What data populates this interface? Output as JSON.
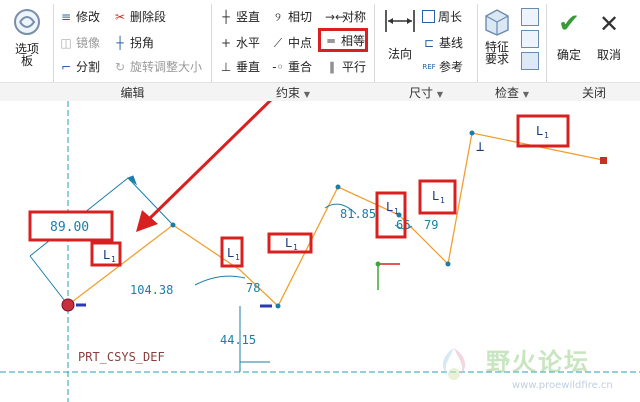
{
  "ribbon": {
    "selection": {
      "label": "选项\n板"
    },
    "edit": {
      "title": "编辑",
      "items": [
        "修改",
        "删除段",
        "镜像",
        "拐角",
        "分割",
        "旋转调整大小"
      ]
    },
    "constraints": {
      "title": "约束",
      "items": [
        "竖直",
        "相切",
        "对称",
        "水平",
        "中点",
        "相等",
        "垂直",
        "重合",
        "平行"
      ]
    },
    "dimension": {
      "title": "尺寸",
      "normal": "法向",
      "items": [
        "周长",
        "基线",
        "参考"
      ]
    },
    "inspect": {
      "title": "检查",
      "feature": "特征\n要求"
    },
    "close": {
      "title": "关闭",
      "ok": "确定",
      "cancel": "取消"
    }
  },
  "sketch": {
    "dims": {
      "angle": "89.00",
      "length": "104.38",
      "angle2": "78",
      "height": "44.15",
      "angle3": "81.85",
      "angle4": "66",
      "angle5": "79"
    },
    "csys_label": "PRT_CSYS_DEF",
    "equal_symbol": "L",
    "equal_subscript": "1"
  },
  "watermark": {
    "brand": "野火论坛",
    "url": "www.proewildfire.cn"
  },
  "colors": {
    "sketch_line": "#f0a030",
    "dimension": "#1a7fa8",
    "highlight": "#d92020",
    "axis": "#2aa0b8"
  }
}
